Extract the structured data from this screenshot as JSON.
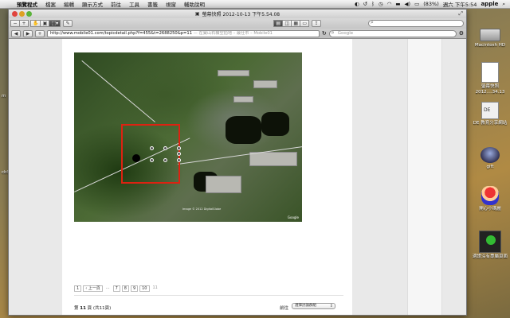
{
  "menubar": {
    "apple": "",
    "items": [
      "預覽程式",
      "檔案",
      "編輯",
      "顯示方式",
      "前往",
      "工具",
      "書籤",
      "視窗",
      "輔助說明"
    ],
    "battery": "(83%)",
    "clock": "週六 下午5:54",
    "user": "apple"
  },
  "window": {
    "title": "螢幕快照 2012-10-13 下午5.54.08"
  },
  "toolbar": {
    "search_placeholder": ""
  },
  "address": {
    "url": "http://www.mobile01.com/topicdetail.php?f=455&t=2688250&p=11",
    "page_title": " — 在寶山石橫空拍地 – 最仕市 – Mobile01",
    "search_placeholder": "Google"
  },
  "map": {
    "copyright": "Image © 2012 DigitalGlobe",
    "logo": "Google"
  },
  "pagination": {
    "first": "1",
    "prev": "‹ 上一頁",
    "ellipsis": "...",
    "pages": [
      "7",
      "8",
      "9",
      "10"
    ],
    "current": "11"
  },
  "footer": {
    "page_info_prefix": "第",
    "page_info_num": "11",
    "page_info_suffix": "頁 (共11頁)",
    "goto_label": "前往",
    "forum_select": "選擇討論群組"
  },
  "desktop": {
    "icons": [
      {
        "label": "Macintosh HD"
      },
      {
        "label": "螢幕快照 2012....34.13"
      },
      {
        "label": "DE 教育分享網站"
      },
      {
        "label": "gift"
      },
      {
        "label": "開心小瑪麗"
      },
      {
        "label": "適證沒有專屬頁面"
      }
    ],
    "left_fragments": [
      "m",
      "cb9"
    ]
  }
}
